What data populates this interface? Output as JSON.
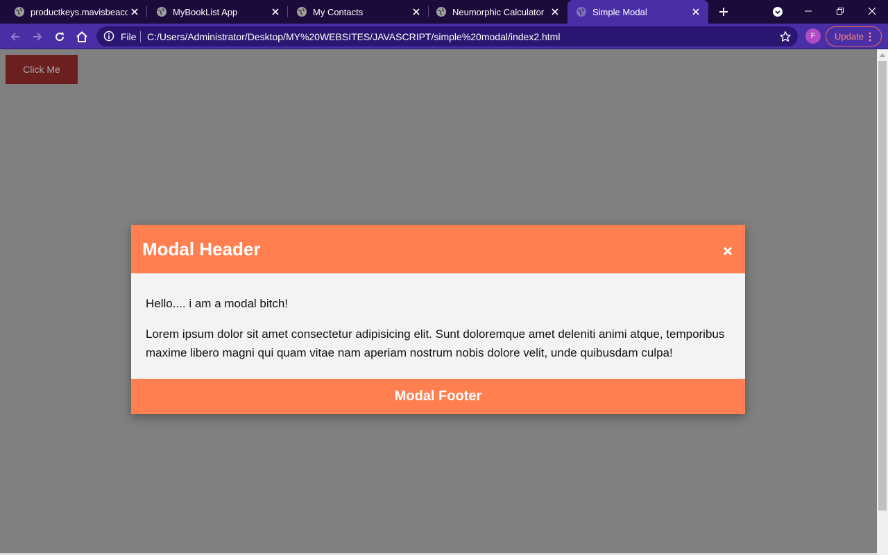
{
  "browser": {
    "tabs": [
      {
        "title": "productkeys.mavisbeacon.",
        "active": false
      },
      {
        "title": "MyBookList App",
        "active": false
      },
      {
        "title": "My Contacts",
        "active": false
      },
      {
        "title": "Neumorphic Calculator",
        "active": false
      },
      {
        "title": "Simple Modal",
        "active": true
      }
    ],
    "omnibox": {
      "scheme_label": "File",
      "url": "C:/Users/Administrator/Desktop/MY%20WEBSITES/JAVASCRIPT/simple%20modal/index2.html"
    },
    "profile_initial": "F",
    "update_label": "Update",
    "colors": {
      "tabstrip": "#1c0a3a",
      "toolbar": "#4a2ea6",
      "omnibox": "#2a1670"
    }
  },
  "page": {
    "click_button_label": "Click Me",
    "overlay_color": "#808080"
  },
  "modal": {
    "header": "Modal Header",
    "close_symbol": "×",
    "body": [
      "Hello.... i am a modal bitch!",
      "Lorem ipsum dolor sit amet consectetur adipisicing elit. Sunt doloremque amet deleniti animi atque, temporibus maxime libero magni qui quam vitae nam aperiam nostrum nobis dolore velit, unde quibusdam culpa!"
    ],
    "footer": "Modal Footer",
    "accent_color": "#ff7f50"
  },
  "icons": [
    "globe-icon",
    "close-icon",
    "plus-icon",
    "chevron-down-icon",
    "minimize-icon",
    "restore-icon",
    "window-close-icon",
    "back-icon",
    "forward-icon",
    "reload-icon",
    "home-icon",
    "info-icon",
    "star-icon",
    "kebab-menu-icon"
  ]
}
